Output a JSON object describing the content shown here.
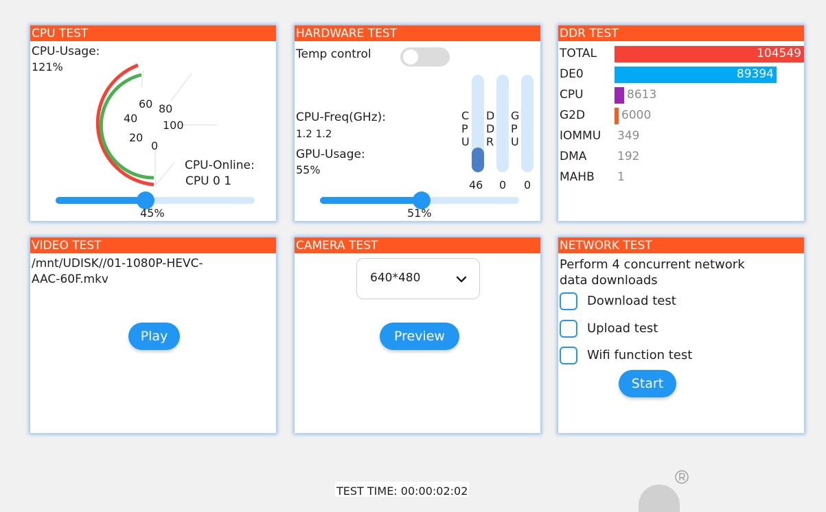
{
  "cpu": {
    "title": "CPU TEST",
    "usage_label": "CPU-Usage:",
    "usage_value": "121%",
    "gauge_ticks": [
      "0",
      "20",
      "40",
      "60",
      "80",
      "100"
    ],
    "online_label": "CPU-Online:",
    "online_value": "CPU 0 1",
    "slider_value": 0.45,
    "slider_text": "45%"
  },
  "hardware": {
    "title": "HARDWARE TEST",
    "temp_label": "Temp control",
    "temp_on": false,
    "freq_label": "CPU-Freq(GHz):",
    "freq_value": "1.2 1.2",
    "gpu_label": "GPU-Usage:",
    "gpu_value": "55%",
    "bars": [
      {
        "letters": "C\nP\nU",
        "fill": 0.25,
        "value": "46"
      },
      {
        "letters": "D\nD\nR",
        "fill": 0,
        "value": "0"
      },
      {
        "letters": "G\nP\nU",
        "fill": 0,
        "value": "0"
      }
    ],
    "slider_value": 0.51,
    "slider_text": "51%"
  },
  "ddr": {
    "title": "DDR TEST",
    "rows": [
      {
        "label": "TOTAL",
        "value": "104549",
        "fraction": 1.0,
        "color": "#f44336"
      },
      {
        "label": "DE0",
        "value": "89394",
        "fraction": 0.855,
        "color": "#03a9f4"
      },
      {
        "label": "CPU",
        "value": "8613",
        "fraction": 0.05,
        "color": "#9c27b0"
      },
      {
        "label": "G2D",
        "value": "6000",
        "fraction": 0.02,
        "color": "#ff5722"
      },
      {
        "label": "IOMMU",
        "value": "349",
        "fraction": 0,
        "color": "#9e9e9e"
      },
      {
        "label": "DMA",
        "value": "192",
        "fraction": 0,
        "color": "#9e9e9e"
      },
      {
        "label": "MAHB",
        "value": "1",
        "fraction": 0,
        "color": "#9e9e9e"
      }
    ]
  },
  "video": {
    "title": "VIDEO TEST",
    "path_line1": "/mnt/UDISK//01-1080P-HEVC-",
    "path_line2": "AAC-60F.mkv",
    "play_label": "Play"
  },
  "camera": {
    "title": "CAMERA TEST",
    "resolution": "640*480",
    "preview_label": "Preview"
  },
  "network": {
    "title": "NETWORK TEST",
    "desc_line1": "Perform 4 concurrent network",
    "desc_line2": "data downloads",
    "checks": [
      "Download test",
      "Upload test",
      "Wifi function test"
    ],
    "start_label": "Start"
  },
  "footer": {
    "test_time": "TEST TIME: 00:00:02:02"
  },
  "colors": {
    "accent": "#2196f3",
    "header": "#ff5722",
    "gauge_outer": "#f44336",
    "gauge_inner": "#4caf50"
  }
}
